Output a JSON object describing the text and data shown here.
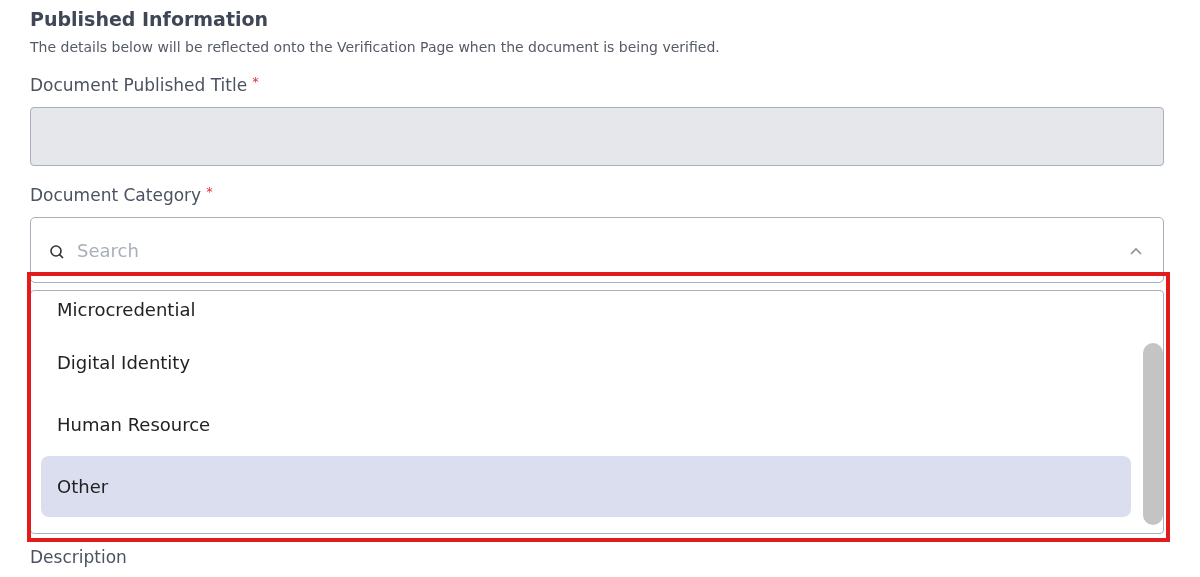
{
  "section": {
    "title": "Published Information",
    "description": "The details below will be reflected onto the Verification Page when the document is being verified."
  },
  "fields": [
    {
      "kind": "text",
      "label": "Document Published Title",
      "required_mark": "*",
      "disabled": true
    },
    {
      "kind": "select",
      "label": "Document Category",
      "required_mark": "*",
      "expanded": true,
      "search": {
        "placeholder": "Search"
      },
      "options": [
        {
          "label": "Microcredential",
          "selected": false
        },
        {
          "label": "Digital Identity",
          "selected": false
        },
        {
          "label": "Human Resource",
          "selected": false
        },
        {
          "label": "Other",
          "selected": true
        }
      ]
    },
    {
      "kind": "label",
      "label": "Description"
    }
  ]
}
